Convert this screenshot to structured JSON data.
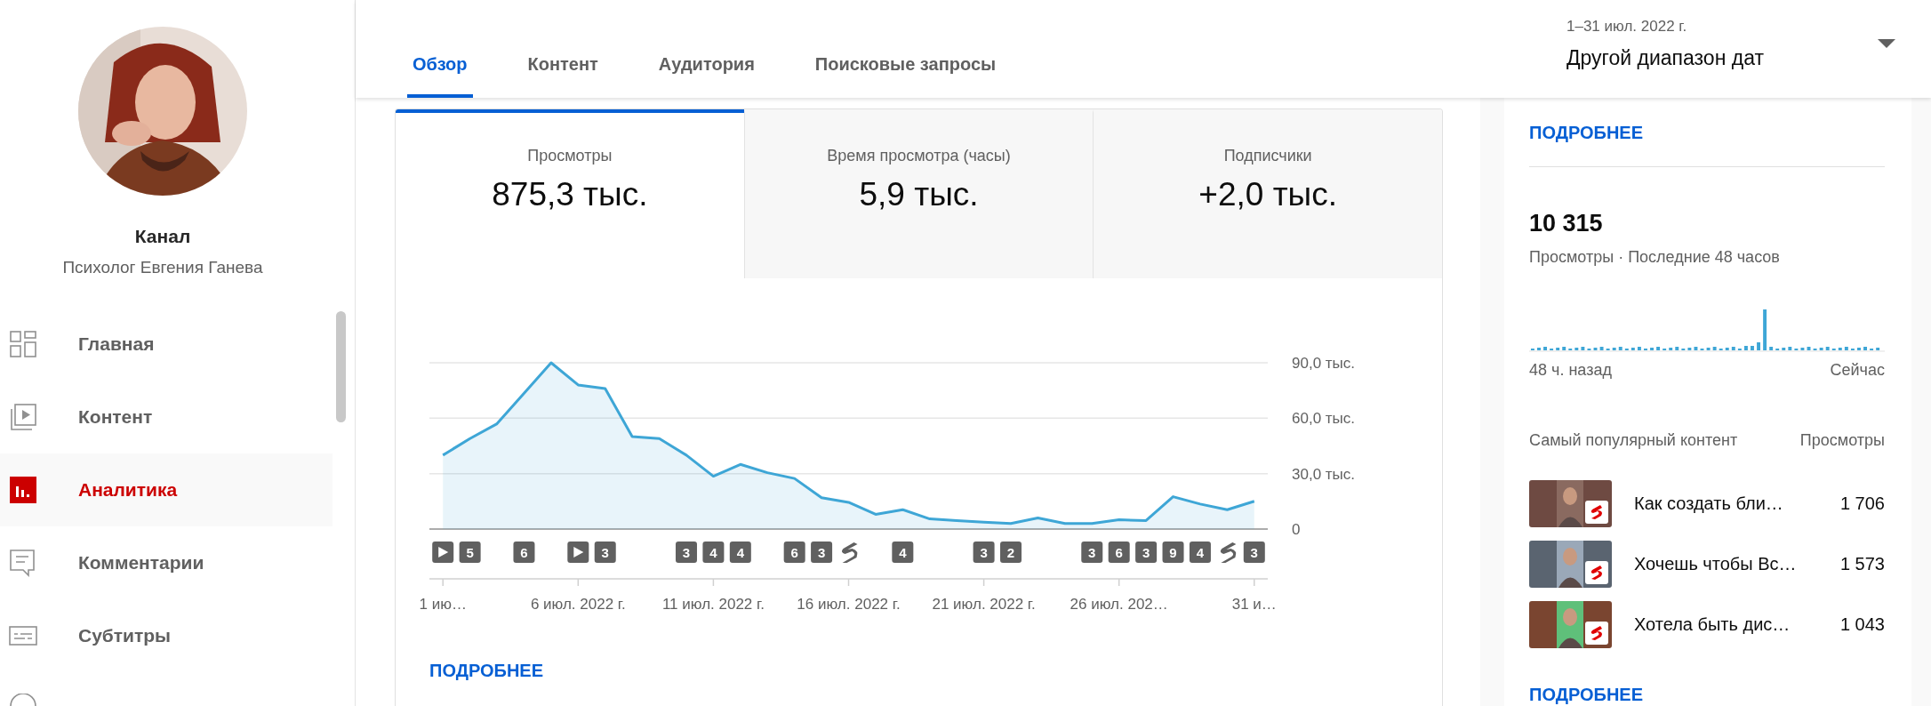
{
  "sidebar": {
    "channel_title": "Канал",
    "channel_name": "Психолог Евгения Ганева",
    "items": [
      {
        "label": "Главная",
        "kind": "dashboard",
        "selected": false
      },
      {
        "label": "Контент",
        "kind": "content",
        "selected": false
      },
      {
        "label": "Аналитика",
        "kind": "analytics",
        "selected": true
      },
      {
        "label": "Комментарии",
        "kind": "comments",
        "selected": false
      },
      {
        "label": "Субтитры",
        "kind": "subtitles",
        "selected": false
      }
    ]
  },
  "tabs": [
    {
      "label": "Обзор",
      "selected": true
    },
    {
      "label": "Контент",
      "selected": false
    },
    {
      "label": "Аудитория",
      "selected": false
    },
    {
      "label": "Поисковые запросы",
      "selected": false
    }
  ],
  "date_range": {
    "period": "1–31 июл. 2022 г.",
    "label": "Другой диапазон дат"
  },
  "metrics": [
    {
      "label": "Просмотры",
      "value": "875,3 тыс.",
      "selected": true
    },
    {
      "label": "Время просмотра (часы)",
      "value": "5,9 тыс.",
      "selected": false
    },
    {
      "label": "Подписчики",
      "value": "+2,0 тыс.",
      "selected": false
    }
  ],
  "chart": {
    "chart_data": {
      "type": "area",
      "categories": [
        "1 ию…",
        null,
        null,
        null,
        null,
        "6 июл. 2022 г.",
        null,
        null,
        null,
        null,
        "11 июл. 2022 г.",
        null,
        null,
        null,
        null,
        "16 июл. 2022 г.",
        null,
        null,
        null,
        null,
        "21 июл. 2022 г.",
        null,
        null,
        null,
        null,
        "26 июл. 202…",
        null,
        null,
        null,
        null,
        "31 и…"
      ],
      "series": [
        {
          "color": "#3ea6d6",
          "values": [
            40,
            49,
            57,
            73.5,
            90,
            78,
            76,
            50,
            49,
            40,
            28.6,
            35,
            30.5,
            27.4,
            17,
            14.5,
            8,
            10.5,
            5.5,
            4.6,
            3.7,
            3,
            6,
            3,
            3,
            5,
            4.6,
            17.5,
            13.5,
            10.5,
            15
          ]
        }
      ],
      "ylim": [
        0,
        90
      ],
      "yticks": [
        {
          "value": 0,
          "label": "0"
        },
        {
          "value": 30,
          "label": "30,0 тыс."
        },
        {
          "value": 60,
          "label": "60,0 тыс."
        },
        {
          "value": 90,
          "label": "90,0 тыс."
        }
      ]
    },
    "markers": [
      {
        "kind": "video"
      },
      {
        "kind": "count",
        "label": "5"
      },
      {
        "kind": "none"
      },
      {
        "kind": "count",
        "label": "6"
      },
      {
        "kind": "none"
      },
      {
        "kind": "video"
      },
      {
        "kind": "count",
        "label": "3"
      },
      {
        "kind": "none"
      },
      {
        "kind": "none"
      },
      {
        "kind": "count",
        "label": "3"
      },
      {
        "kind": "count",
        "label": "4"
      },
      {
        "kind": "count",
        "label": "4"
      },
      {
        "kind": "none"
      },
      {
        "kind": "count",
        "label": "6"
      },
      {
        "kind": "count",
        "label": "3"
      },
      {
        "kind": "short"
      },
      {
        "kind": "none"
      },
      {
        "kind": "count",
        "label": "4"
      },
      {
        "kind": "none"
      },
      {
        "kind": "none"
      },
      {
        "kind": "count",
        "label": "3"
      },
      {
        "kind": "count",
        "label": "2"
      },
      {
        "kind": "none"
      },
      {
        "kind": "none"
      },
      {
        "kind": "count",
        "label": "3"
      },
      {
        "kind": "count",
        "label": "6"
      },
      {
        "kind": "count",
        "label": "3"
      },
      {
        "kind": "count",
        "label": "9"
      },
      {
        "kind": "count",
        "label": "4"
      },
      {
        "kind": "short"
      },
      {
        "kind": "count",
        "label": "3"
      }
    ],
    "more_link": "ПОДРОБНЕЕ"
  },
  "side_panel": {
    "top_link": "ПОДРОБНЕЕ",
    "realtime_value": "10 315",
    "realtime_caption": "Просмотры · Последние 48 часов",
    "spark_start": "48 ч. назад",
    "spark_end": "Сейчас",
    "content_header": "Самый популярный контент",
    "views_header": "Просмотры",
    "top_content": [
      {
        "title": "Как создать бли…",
        "views": "1 706"
      },
      {
        "title": "Хочешь чтобы Вс…",
        "views": "1 573"
      },
      {
        "title": "Хотела быть дис…",
        "views": "1 043"
      }
    ],
    "bottom_link": "ПОДРОБНЕЕ"
  }
}
